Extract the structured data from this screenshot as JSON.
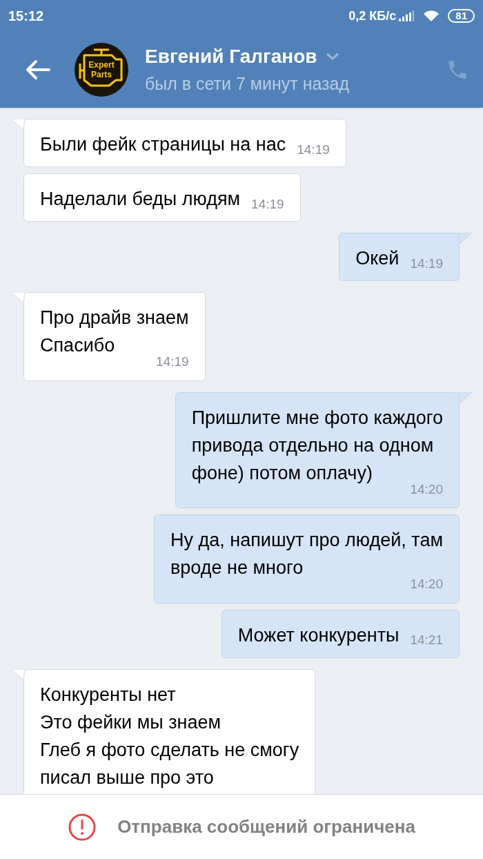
{
  "status_bar": {
    "time": "15:12",
    "speed": "0,2 КБ/с",
    "battery": "81"
  },
  "header": {
    "name": "Евгений Галганов",
    "status": "был в сети 7 минут назад",
    "avatar_text": [
      "Expert",
      "Parts"
    ]
  },
  "messages": [
    {
      "kind": "incoming",
      "text": "Были фейк страницы на нас",
      "time": "14:19"
    },
    {
      "kind": "incoming",
      "text": "Наделали беды людям",
      "time": "14:19"
    },
    {
      "kind": "outgoing",
      "text": "Окей",
      "time": "14:19"
    },
    {
      "kind": "incoming",
      "text": "Про драйв знаем\nСпасибо",
      "time": "14:19"
    },
    {
      "kind": "outgoing",
      "text": "Пришлите мне фото каждого\nпривода отдельно на одном\nфоне) потом оплачу)",
      "time": "14:20"
    },
    {
      "kind": "outgoing",
      "text": "Ну да,  напишут про людей,  там\nвроде не много",
      "time": "14:20"
    },
    {
      "kind": "outgoing",
      "text": "Может конкуренты",
      "time": "14:21"
    },
    {
      "kind": "incoming",
      "text": "Конкуренты нет\nЭто фейки мы знаем\nГлеб я фото сделать не смогу\nписал выше про это"
    }
  ],
  "notice": "Отправка сообщений ограничена"
}
